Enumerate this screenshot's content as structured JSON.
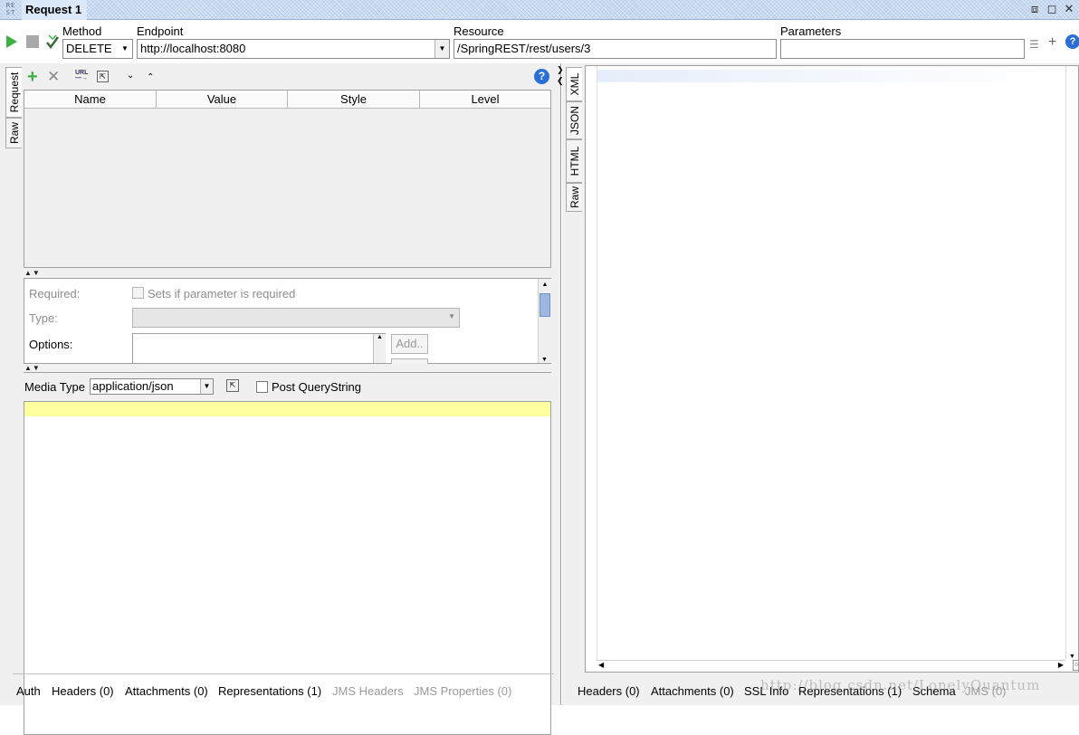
{
  "window": {
    "title": "Request 1",
    "icon_text": "RE ST"
  },
  "labels": {
    "method": "Method",
    "endpoint": "Endpoint",
    "resource": "Resource",
    "parameters": "Parameters"
  },
  "fields": {
    "method_value": "DELETE",
    "endpoint_value": "http://localhost:8080",
    "resource_value": "/SpringREST/rest/users/3",
    "parameters_value": ""
  },
  "request_tabs": [
    "Request",
    "Raw"
  ],
  "param_table": {
    "columns": [
      "Name",
      "Value",
      "Style",
      "Level"
    ]
  },
  "param_details": {
    "required_label": "Required:",
    "required_checkbox": "Sets if parameter is required",
    "type_label": "Type:",
    "options_label": "Options:",
    "add_button": "Add.."
  },
  "media": {
    "label": "Media Type",
    "value": "application/json",
    "post_querystring": "Post QueryString"
  },
  "left_bottom_tabs": [
    "Auth",
    "Headers (0)",
    "Attachments (0)",
    "Representations (1)",
    "JMS Headers",
    "JMS Properties (0)"
  ],
  "response_tabs": [
    "XML",
    "JSON",
    "HTML",
    "Raw"
  ],
  "right_bottom_tabs": [
    "Headers (0)",
    "Attachments (0)",
    "SSL Info",
    "Representations (1)",
    "Schema",
    "JMS (0)"
  ],
  "watermark": "http://blog.csdn.net/LonelyQuantum",
  "colors": {
    "accent_green": "#3cb043",
    "title_blue": "#c6d9f1",
    "highlight_yellow": "#ffffa0",
    "help_blue": "#2a6fd6"
  },
  "icons": [
    "play-icon",
    "stop-icon",
    "check-icon",
    "add-icon",
    "delete-icon",
    "help-icon",
    "restore-icon",
    "maximize-icon",
    "close-icon"
  ]
}
